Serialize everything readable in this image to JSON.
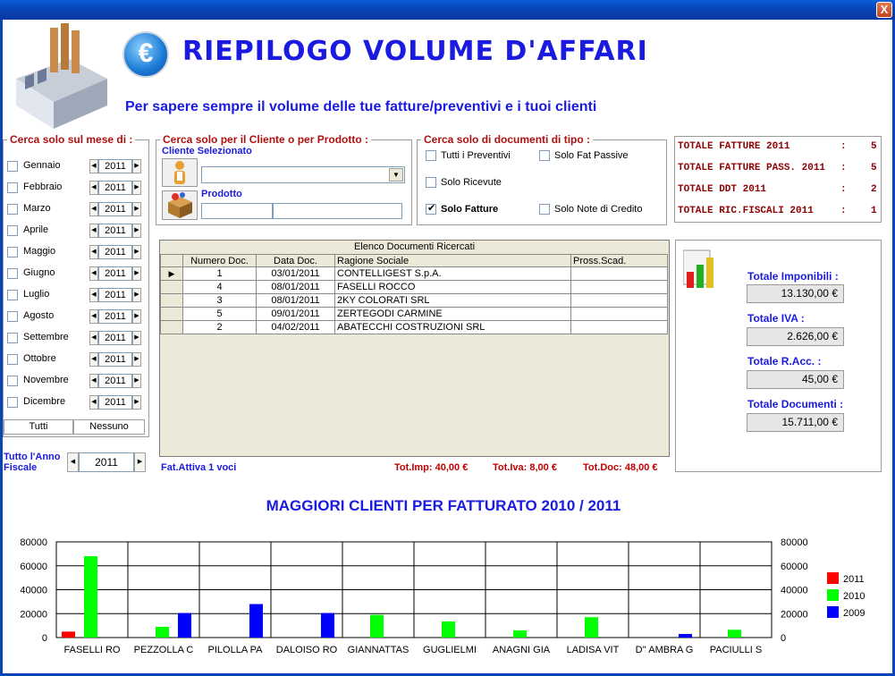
{
  "window": {
    "close_label": "X"
  },
  "header": {
    "euro_symbol": "€",
    "title": "RIEPILOGO VOLUME D'AFFARI",
    "subtitle": "Per sapere sempre il volume delle tue fatture/preventivi e i tuoi clienti"
  },
  "months_filter": {
    "legend": "Cerca solo sul mese di :",
    "months": [
      {
        "label": "Gennaio",
        "year": "2011"
      },
      {
        "label": "Febbraio",
        "year": "2011"
      },
      {
        "label": "Marzo",
        "year": "2011"
      },
      {
        "label": "Aprile",
        "year": "2011"
      },
      {
        "label": "Maggio",
        "year": "2011"
      },
      {
        "label": "Giugno",
        "year": "2011"
      },
      {
        "label": "Luglio",
        "year": "2011"
      },
      {
        "label": "Agosto",
        "year": "2011"
      },
      {
        "label": "Settembre",
        "year": "2011"
      },
      {
        "label": "Ottobre",
        "year": "2011"
      },
      {
        "label": "Novembre",
        "year": "2011"
      },
      {
        "label": "Dicembre",
        "year": "2011"
      }
    ],
    "all_label": "Tutti",
    "none_label": "Nessuno",
    "fiscal_label_1": "Tutto l'Anno",
    "fiscal_label_2": "Fiscale",
    "fiscal_year": "2011"
  },
  "client_filter": {
    "legend": "Cerca solo per il Cliente o per Prodotto :",
    "client_label": "Cliente Selezionato",
    "client_value": "",
    "product_label": "Prodotto",
    "product_code": "",
    "product_desc": ""
  },
  "doc_type_filter": {
    "legend": "Cerca solo di documenti di tipo :",
    "options": [
      {
        "label": "Tutti i Preventivi",
        "checked": false
      },
      {
        "label": "Solo Fat Passive",
        "checked": false
      },
      {
        "label": "Solo Ricevute",
        "checked": false
      },
      {
        "label": "Solo Fatture",
        "checked": true
      },
      {
        "label": "Solo Note di Credito",
        "checked": false
      }
    ]
  },
  "totals_summary": [
    {
      "label": "TOTALE FATTURE 2011",
      "sep": ":",
      "value": "5"
    },
    {
      "label": "TOTALE FATTURE PASS. 2011",
      "sep": ":",
      "value": "5"
    },
    {
      "label": "TOTALE DDT 2011",
      "sep": ":",
      "value": "2"
    },
    {
      "label": "TOTALE RIC.FISCALI 2011",
      "sep": ":",
      "value": "1"
    }
  ],
  "doc_list": {
    "caption": "Elenco Documenti Ricercati",
    "columns": [
      "Numero Doc.",
      "Data Doc.",
      "Ragione Sociale",
      "Pross.Scad."
    ],
    "rows": [
      [
        "1",
        "03/01/2011",
        "CONTELLIGEST S.p.A.",
        ""
      ],
      [
        "4",
        "08/01/2011",
        "FASELLI ROCCO",
        ""
      ],
      [
        "3",
        "08/01/2011",
        "2KY COLORATI SRL",
        ""
      ],
      [
        "5",
        "09/01/2011",
        "ZERTEGODI CARMINE",
        ""
      ],
      [
        "2",
        "04/02/2011",
        "ABATECCHI COSTRUZIONI SRL",
        ""
      ]
    ],
    "row_pointer": "▶",
    "footer_left": "Fat.Attiva 1 voci",
    "tot_imp": "Tot.Imp: 40,00 €",
    "tot_iva": "Tot.Iva: 8,00 €",
    "tot_doc": "Tot.Doc: 48,00 €"
  },
  "totals_panel": {
    "imponibili_label": "Totale Imponibili :",
    "imponibili_value": "13.130,00 €",
    "iva_label": "Totale IVA :",
    "iva_value": "2.626,00 €",
    "racc_label": "Totale R.Acc. :",
    "racc_value": "45,00 €",
    "documenti_label": "Totale Documenti :",
    "documenti_value": "15.711,00 €"
  },
  "chart_data": {
    "type": "bar",
    "title": "MAGGIORI CLIENTI PER FATTURATO 2010 / 2011",
    "categories": [
      "FASELLI RO",
      "PEZZOLLA C",
      "PILOLLA PA",
      "DALOISO RO",
      "GIANNATTAS",
      "GUGLIELMI",
      "ANAGNI GIA",
      "LADISA VIT",
      "D'' AMBRA G",
      "PACIULLI S"
    ],
    "series": [
      {
        "name": "2011",
        "color": "#ff0000",
        "values": [
          5000,
          0,
          0,
          0,
          0,
          0,
          0,
          0,
          0,
          0
        ]
      },
      {
        "name": "2010",
        "color": "#00ff00",
        "values": [
          68000,
          9000,
          0,
          0,
          19000,
          13500,
          6000,
          17000,
          0,
          6500
        ]
      },
      {
        "name": "2009",
        "color": "#0000ff",
        "values": [
          0,
          20500,
          28000,
          20500,
          0,
          0,
          0,
          0,
          3000,
          0
        ]
      }
    ],
    "ylim": [
      0,
      80000
    ],
    "yticks": [
      "0",
      "20000",
      "40000",
      "60000",
      "80000"
    ],
    "grid": true,
    "legend": "right"
  }
}
